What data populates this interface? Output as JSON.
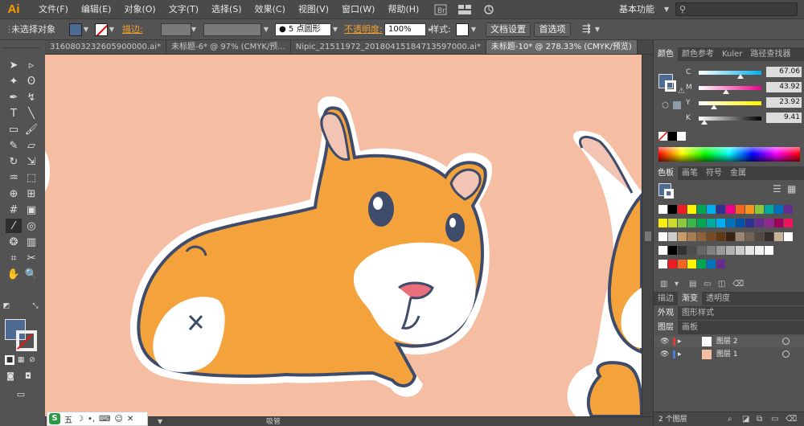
{
  "app": {
    "logo": "Ai"
  },
  "menu": [
    "文件(F)",
    "编辑(E)",
    "对象(O)",
    "文字(T)",
    "选择(S)",
    "效果(C)",
    "视图(V)",
    "窗口(W)",
    "帮助(H)"
  ],
  "menubar_icons": [
    "bridge-icon",
    "arrange-documents-icon",
    "gpu-sync-icon"
  ],
  "workspace": {
    "label": "基本功能",
    "search_placeholder": ""
  },
  "controlbar": {
    "selection": "未选择对象",
    "fill_color": "#4d6b93",
    "stroke_label": "描边:",
    "brush": "5 点圆形",
    "opacity_label": "不透明度:",
    "opacity_value": "100%",
    "style_label": "样式:",
    "doc_setup": "文档设置",
    "preferences": "首选项"
  },
  "tabs": [
    {
      "label": "3160803232605900000.ai*",
      "active": false
    },
    {
      "label": "未标题-6* @ 97% (CMYK/预...",
      "active": false
    },
    {
      "label": "Nipic_21511972_20180415184713597000.ai*",
      "active": false
    },
    {
      "label": "未标题-10* @ 278.33% (CMYK/预览)",
      "active": true
    }
  ],
  "canvas": {
    "background": "#f5bea3"
  },
  "statusbar": {
    "tool": "吸管"
  },
  "ime": {
    "brand": "S",
    "label": "五"
  },
  "color_panel": {
    "tabs": [
      "颜色",
      "颜色参考",
      "Kuler",
      "路径查找器"
    ],
    "channels": [
      {
        "name": "C",
        "value": "67.06",
        "pos": 0.67,
        "gradient": "linear-gradient(to right,#fff,#00aeef)"
      },
      {
        "name": "M",
        "value": "43.92",
        "pos": 0.44,
        "gradient": "linear-gradient(to right,#fff,#ec008c)"
      },
      {
        "name": "Y",
        "value": "23.92",
        "pos": 0.24,
        "gradient": "linear-gradient(to right,#fff,#fff200)"
      },
      {
        "name": "K",
        "value": "9.41",
        "pos": 0.09,
        "gradient": "linear-gradient(to right,#fff,#000)"
      }
    ]
  },
  "swatches_panel": {
    "tabs": [
      "色板",
      "画笔",
      "符号",
      "金属"
    ]
  },
  "stroke_panel": {
    "tabs": [
      "描边",
      "渐变",
      "透明度"
    ]
  },
  "appearance_panel": {
    "tabs": [
      "外观",
      "图形样式"
    ]
  },
  "layers_panel": {
    "tabs": [
      "图层",
      "画板"
    ],
    "layers": [
      {
        "name": "图层 2",
        "color": "#e33a3a"
      },
      {
        "name": "图层 1",
        "color": "#4a7fd6"
      }
    ],
    "count": "2 个图层"
  }
}
